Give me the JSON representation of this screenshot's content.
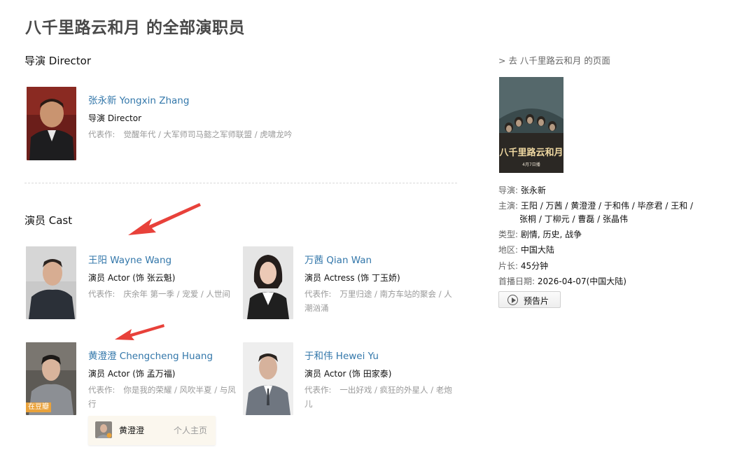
{
  "page": {
    "title": "八千里路云和月 的全部演职员"
  },
  "sections": {
    "director": "导演 Director",
    "cast": "演员 Cast"
  },
  "director": {
    "name": "张永新 Yongxin Zhang",
    "role": "导演 Director",
    "works_label": "代表作:",
    "works": "觉醒年代 / 大军师司马懿之军师联盟 / 虎啸龙吟"
  },
  "cast": [
    {
      "name": "王阳 Wayne Wang",
      "role": "演员 Actor (饰 张云魁)",
      "works_label": "代表作:",
      "works": "庆余年 第一季 / 宠爱 / 人世间"
    },
    {
      "name": "万茜 Qian Wan",
      "role": "演员 Actress (饰 丁玉娇)",
      "works_label": "代表作:",
      "works": "万里归途 / 南方车站的聚会 / 人潮汹涌"
    },
    {
      "name": "黄澄澄 Chengcheng Huang",
      "role": "演员 Actor (饰 孟万福)",
      "works_label": "代表作:",
      "works": "你是我的荣耀 / 风吹半夏 / 与凤行",
      "badge": "在豆瓣"
    },
    {
      "name": "于和伟 Hewei Yu",
      "role": "演员 Actor (饰 田家泰)",
      "works_label": "代表作:",
      "works": "一出好戏 / 疯狂的外星人 / 老炮儿"
    }
  ],
  "hover_card": {
    "name": "黄澄澄",
    "link": "个人主页"
  },
  "sidebar": {
    "back_link": "> 去 八千里路云和月 的页面",
    "poster": {
      "title_text": "八千里路云和月",
      "date_text": "4月7日播"
    },
    "director": {
      "key": "导演:",
      "value": "张永新"
    },
    "stars": {
      "key": "主演:",
      "line1": "王阳 / 万茜 / 黄澄澄 / 于和伟 / 毕彦君 / 王和 /",
      "line2": "张桐 / 丁柳元 / 曹磊 / 张晶伟"
    },
    "genre": {
      "key": "类型:",
      "value": "剧情, 历史, 战争"
    },
    "region": {
      "key": "地区:",
      "value": "中国大陆"
    },
    "length": {
      "key": "片长:",
      "value": "45分钟"
    },
    "premiere": {
      "key": "首播日期:",
      "value": "2026-04-07(中国大陆)"
    },
    "trailer_button": "预告片"
  },
  "colors": {
    "link": "#3377aa",
    "accent_arrow": "#e8413a",
    "badge": "#e9a23b"
  }
}
